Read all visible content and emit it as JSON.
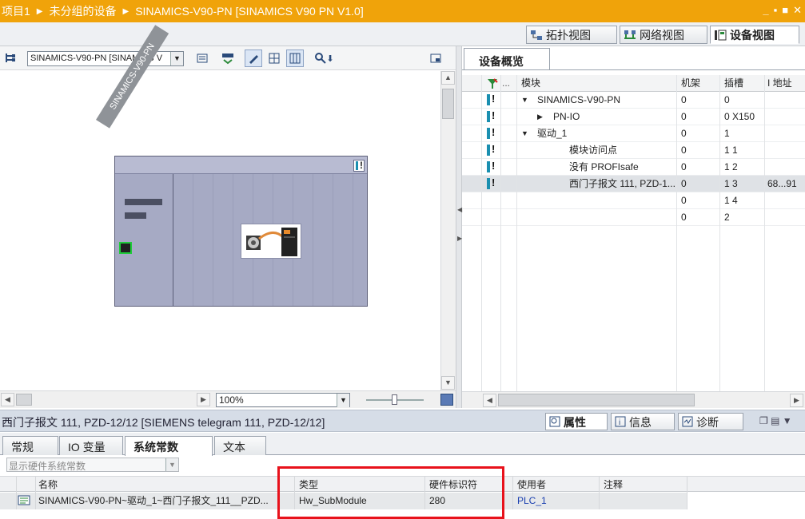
{
  "title_bar": {
    "breadcrumbs": [
      "项目1",
      "未分组的设备",
      "SINAMICS-V90-PN [SINAMICS V90 PN V1.0]"
    ],
    "window_buttons": [
      "_",
      "▪",
      "■",
      "✕"
    ]
  },
  "view_tabs": [
    {
      "label": "拓扑视图",
      "icon": "topology-icon",
      "active": false
    },
    {
      "label": "网络视图",
      "icon": "network-icon",
      "active": false
    },
    {
      "label": "设备视图",
      "icon": "device-icon",
      "active": true
    }
  ],
  "device_toolbar": {
    "device_select": "SINAMICS-V90-PN [SINAMICS V"
  },
  "canvas": {
    "device_label": "SINAMICS-V90-PN",
    "zoom": "100%"
  },
  "overview": {
    "tab_label": "设备概览",
    "columns": [
      "模块",
      "机架",
      "插槽",
      "I 地址"
    ],
    "rows": [
      {
        "module": "SINAMICS-V90-PN",
        "rack": "0",
        "slot": "0",
        "addr": "",
        "icon": true,
        "expander": "▼",
        "indent": 0
      },
      {
        "module": "PN-IO",
        "rack": "0",
        "slot": "0 X150",
        "addr": "",
        "icon": true,
        "expander": "▶",
        "indent": 1
      },
      {
        "module": "驱动_1",
        "rack": "0",
        "slot": "1",
        "addr": "",
        "icon": true,
        "expander": "▼",
        "indent": 0
      },
      {
        "module": "模块访问点",
        "rack": "0",
        "slot": "1 1",
        "addr": "",
        "icon": true,
        "expander": "",
        "indent": 2
      },
      {
        "module": "没有 PROFIsafe",
        "rack": "0",
        "slot": "1 2",
        "addr": "",
        "icon": true,
        "expander": "",
        "indent": 2
      },
      {
        "module": "西门子报文 111, PZD-1...",
        "rack": "0",
        "slot": "1 3",
        "addr": "68...91",
        "icon": true,
        "expander": "",
        "indent": 2,
        "selected": true
      },
      {
        "module": "",
        "rack": "0",
        "slot": "1 4",
        "addr": "",
        "icon": false,
        "expander": "",
        "indent": 0
      },
      {
        "module": "",
        "rack": "0",
        "slot": "2",
        "addr": "",
        "icon": false,
        "expander": "",
        "indent": 0
      }
    ]
  },
  "properties": {
    "title": "西门子报文 111, PZD-12/12 [SIEMENS telegram 111, PZD-12/12]",
    "inspector_tabs": [
      {
        "label": "属性",
        "icon": "properties-icon",
        "active": true
      },
      {
        "label": "信息",
        "icon": "info-icon",
        "active": false
      },
      {
        "label": "诊断",
        "icon": "diagnostics-icon",
        "active": false
      }
    ],
    "sub_tabs": [
      {
        "label": "常规",
        "active": false
      },
      {
        "label": "IO 变量",
        "active": false
      },
      {
        "label": "系统常数",
        "active": true
      },
      {
        "label": "文本",
        "active": false
      }
    ],
    "filter_select": "显示硬件系统常数",
    "table_columns": [
      "名称",
      "类型",
      "硬件标识符",
      "使用者",
      "注释"
    ],
    "table_rows": [
      {
        "name": "SINAMICS-V90-PN~驱动_1~西门子报文_111__PZD...",
        "type": "Hw_SubModule",
        "hw_id": "280",
        "used_by": "PLC_1",
        "comment": ""
      }
    ]
  }
}
